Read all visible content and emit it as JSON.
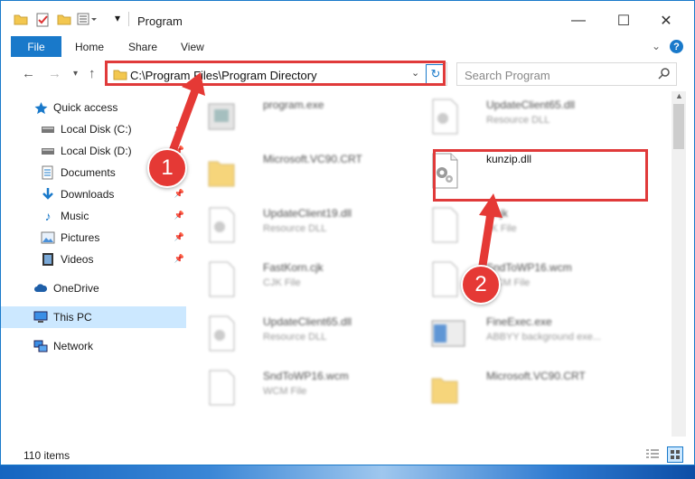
{
  "window": {
    "title": "Program",
    "controls": {
      "minimize": "—",
      "maximize": "☐",
      "close": "✕"
    }
  },
  "ribbon": {
    "file": "File",
    "tabs": [
      "Home",
      "Share",
      "View"
    ]
  },
  "address": {
    "path": "C:\\Program Files\\Program Directory"
  },
  "search": {
    "placeholder": "Search Program"
  },
  "nav": {
    "items": [
      {
        "label": "Quick access",
        "icon": "star-icon",
        "pinned": false
      },
      {
        "label": "Local Disk (C:)",
        "icon": "drive-icon",
        "pinned": true
      },
      {
        "label": "Local Disk (D:)",
        "icon": "drive-icon",
        "pinned": true
      },
      {
        "label": "Documents",
        "icon": "documents-icon",
        "pinned": true
      },
      {
        "label": "Downloads",
        "icon": "download-icon",
        "pinned": true
      },
      {
        "label": "Music",
        "icon": "music-icon",
        "pinned": true
      },
      {
        "label": "Pictures",
        "icon": "pictures-icon",
        "pinned": true
      },
      {
        "label": "Videos",
        "icon": "video-icon",
        "pinned": true
      },
      {
        "label": "OneDrive",
        "icon": "cloud-icon",
        "pinned": false
      },
      {
        "label": "This PC",
        "icon": "pc-icon",
        "pinned": false,
        "selected": true
      },
      {
        "label": "Network",
        "icon": "network-icon",
        "pinned": false
      }
    ]
  },
  "files": [
    {
      "name": "program.exe",
      "type": "",
      "icon": "exe-icon",
      "blurred": true
    },
    {
      "name": "UpdateClient65.dll",
      "type": "Resource DLL",
      "icon": "dll-icon",
      "blurred": true
    },
    {
      "name": "Microsoft.VC90.CRT",
      "type": "",
      "icon": "folder-icon",
      "blurred": true
    },
    {
      "name": "kunzip.dll",
      "type": "",
      "icon": "dll-icon",
      "blurred": false
    },
    {
      "name": "UpdateClient19.dll",
      "type": "Resource DLL",
      "icon": "dll-icon",
      "blurred": true
    },
    {
      "name": "Jtl.jk",
      "type": "JK File",
      "icon": "file-icon",
      "blurred": true
    },
    {
      "name": "FastKorn.cjk",
      "type": "CJK File",
      "icon": "file-icon",
      "blurred": true
    },
    {
      "name": "SndToWP16.wcm",
      "type": "WCM File",
      "icon": "file-icon",
      "blurred": true
    },
    {
      "name": "UpdateClient65.dll",
      "type": "Resource DLL",
      "icon": "dll-icon",
      "blurred": true
    },
    {
      "name": "FineExec.exe",
      "type": "ABBYY background exe...",
      "icon": "app-icon",
      "blurred": true
    },
    {
      "name": "SndToWP16.wcm",
      "type": "WCM File",
      "icon": "file-icon",
      "blurred": true
    },
    {
      "name": "Microsoft.VC90.CRT",
      "type": "",
      "icon": "folder-icon",
      "blurred": true
    }
  ],
  "status": {
    "count": "110 items"
  },
  "annotations": {
    "step1": "1",
    "step2": "2",
    "color": "#e03a3a"
  }
}
